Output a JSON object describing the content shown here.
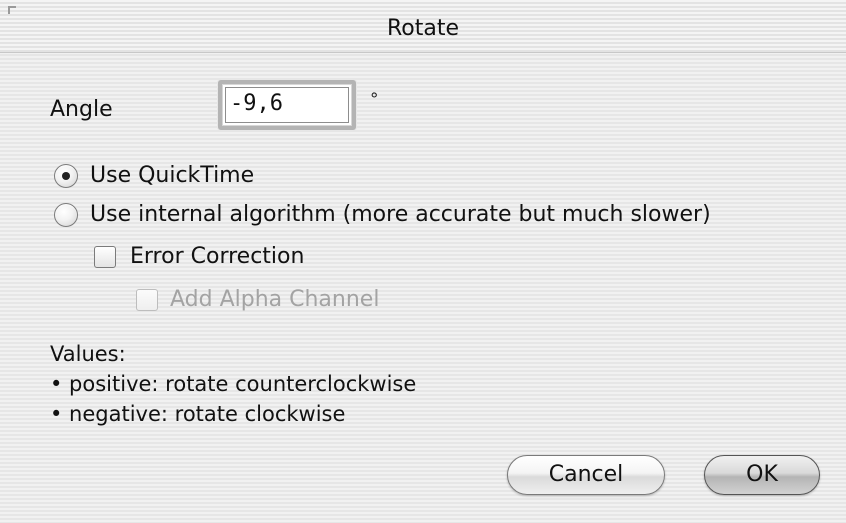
{
  "window": {
    "title": "Rotate"
  },
  "angle": {
    "label": "Angle",
    "value": "-9,6",
    "unit": "°"
  },
  "options": {
    "use_quicktime": {
      "label": "Use QuickTime",
      "checked": true
    },
    "use_internal": {
      "label": "Use internal algorithm (more accurate but much slower)",
      "checked": false
    },
    "error_correction": {
      "label": "Error Correction",
      "checked": false,
      "enabled": true
    },
    "add_alpha_channel": {
      "label": "Add Alpha Channel",
      "checked": false,
      "enabled": false
    }
  },
  "help": {
    "heading": "Values:",
    "positive": "• positive: rotate counterclockwise",
    "negative": "• negative: rotate clockwise"
  },
  "buttons": {
    "cancel": "Cancel",
    "ok": "OK"
  }
}
